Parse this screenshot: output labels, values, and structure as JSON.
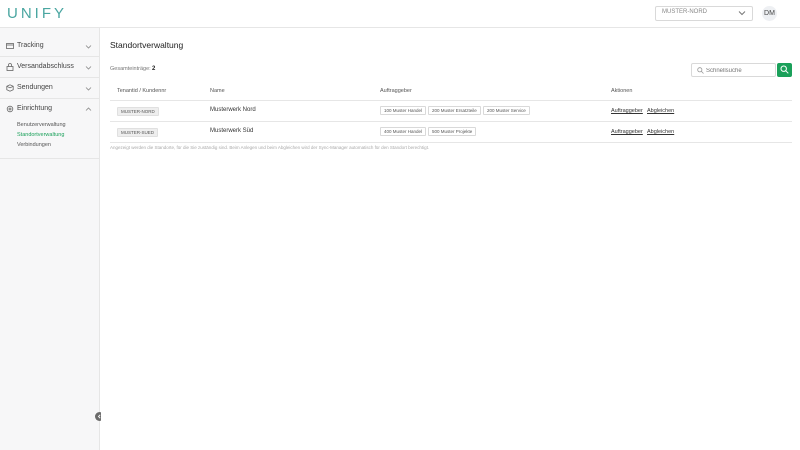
{
  "header": {
    "logo": "UNIFY",
    "tenant_select": "MUSTER-NORD",
    "avatar": "DM"
  },
  "sidebar": {
    "items": [
      {
        "label": "Tracking",
        "icon": "box-icon"
      },
      {
        "label": "Versandabschluss",
        "icon": "lock-icon"
      },
      {
        "label": "Sendungen",
        "icon": "parcel-icon"
      },
      {
        "label": "Einrichtung",
        "icon": "gear-icon"
      }
    ],
    "sub_items": [
      {
        "label": "Benutzerverwaltung"
      },
      {
        "label": "Standortverwaltung"
      },
      {
        "label": "Verbindungen"
      }
    ]
  },
  "main": {
    "title": "Standortverwaltung",
    "total_label": "Gesamteinträge:",
    "total_count": "2",
    "search_placeholder": "Schnellsuche",
    "columns": [
      "Tenantid / Kundennr",
      "Name",
      "Auftraggeber",
      "Aktionen"
    ],
    "rows": [
      {
        "tenant": "MUSTER-NORD",
        "name": "Musterwerk Nord",
        "clients": [
          "100 Muster Handel",
          "200 Muster Ersatzteile",
          "200 Muster Service"
        ],
        "actions": [
          "Auftraggeber",
          "Abgleichen"
        ]
      },
      {
        "tenant": "MUSTER-SUED",
        "name": "Musterwerk Süd",
        "clients": [
          "400 Muster Handel",
          "500 Muster Projekte"
        ],
        "actions": [
          "Auftraggeber",
          "Abgleichen"
        ]
      }
    ],
    "footnote": "Angezeigt werden die Standorte, für die Sie zuständig sind. Beim Anlegen und beim Abgleichen wird der Sync-Manager automatisch für den Standort berechtigt."
  },
  "colors": {
    "accent": "#1aa05a",
    "logo": "#4aa6a1"
  }
}
